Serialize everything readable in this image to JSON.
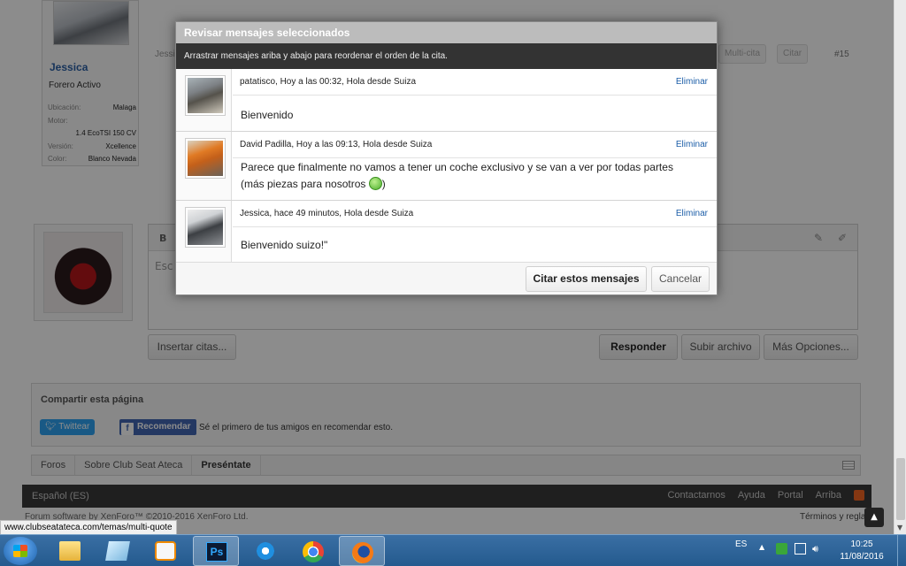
{
  "forum": {
    "user": {
      "name": "Jessica",
      "title": "Forero Activo",
      "info": [
        {
          "key": "Ubicación:",
          "value": "Malaga"
        },
        {
          "key": "Motor:",
          "value": ""
        },
        {
          "key": "",
          "value": "1.4 EcoTSI 150 CV"
        },
        {
          "key": "Versión:",
          "value": "Xcellence"
        },
        {
          "key": "Color:",
          "value": "Blanco Nevada"
        }
      ]
    },
    "post_author": "Jessi",
    "multi_quote_label": "Multi-cita",
    "quote_label": "Citar",
    "post_number": "#15",
    "editor_placeholder": "Esc",
    "editor_bold": "B",
    "buttons": {
      "insert_quotes": "Insertar citas...",
      "reply": "Responder",
      "upload": "Subir archivo",
      "more_options": "Más Opciones..."
    },
    "share": {
      "title": "Compartir esta página",
      "twitter": "Twittear",
      "facebook": "Recomendar",
      "facebook_text": "Sé el primero de tus amigos en recomendar esto."
    },
    "breadcrumb": [
      "Foros",
      "Sobre Club Seat Ateca",
      "Preséntate"
    ],
    "footer": {
      "language": "Español (ES)",
      "links": [
        "Contactarnos",
        "Ayuda",
        "Portal",
        "Arriba"
      ],
      "copyright": "Forum software by XenForo™ ©2010-2016 XenForo Ltd.",
      "terms": "Términos y reglas"
    },
    "status_url": "www.clubseatateca.com/temas/multi-quote"
  },
  "modal": {
    "title": "Revisar mensajes seleccionados",
    "subtitle": "Arrastrar mensajes ariba y abajo para reordenar el orden de la cita.",
    "messages": [
      {
        "meta": "patatisco, Hoy a las 00:32, Hola desde Suiza",
        "delete": "Eliminar",
        "body": "Bienvenido"
      },
      {
        "meta": "David Padilla, Hoy a las 09:13, Hola desde Suiza",
        "delete": "Eliminar",
        "body": "Parece que finalmente no vamos a tener un coche exclusivo y se van a ver por todas partes (más piezas para nosotros",
        "body_end": ")"
      },
      {
        "meta": "Jessica, hace 49 minutos, Hola desde Suiza",
        "delete": "Eliminar",
        "body": "Bienvenido suizo!\""
      }
    ],
    "quote_button": "Citar estos mensajes",
    "cancel_button": "Cancelar"
  },
  "taskbar": {
    "language": "ES",
    "time": "10:25",
    "date": "11/08/2016",
    "apps": [
      "windows-explorer",
      "notes",
      "media-player",
      "photoshop",
      "internet-explorer",
      "chrome",
      "firefox"
    ],
    "photoshop_label": "Ps"
  }
}
